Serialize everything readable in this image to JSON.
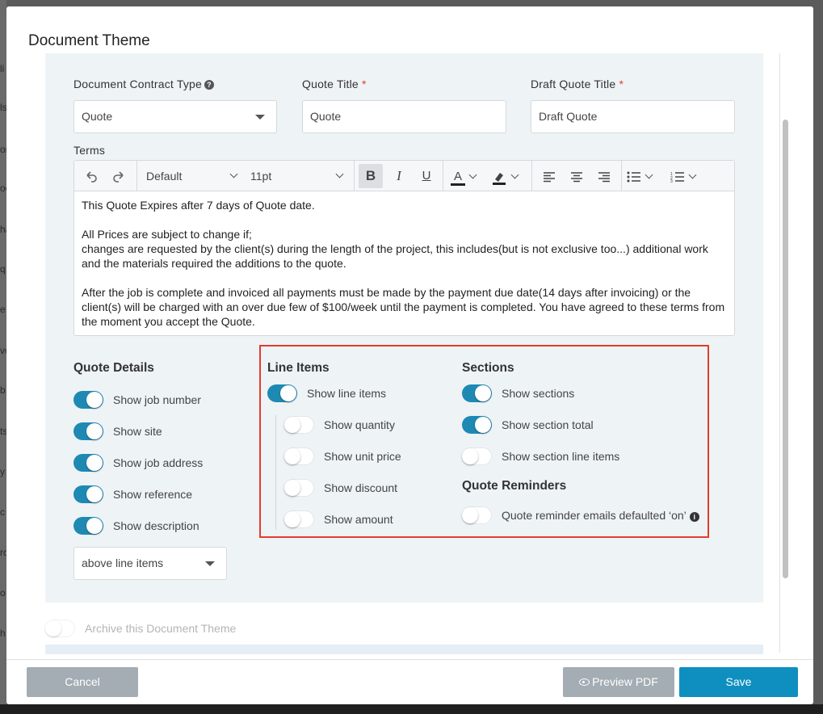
{
  "background_fragments": [
    "li",
    "ls",
    "on",
    "oc",
    "ha",
    "q",
    "e",
    "vo",
    "b",
    "ts",
    "y",
    "c",
    "rc",
    "o",
    "h"
  ],
  "modal": {
    "title": "Document Theme"
  },
  "fields": {
    "contract_type": {
      "label": "Document Contract Type",
      "value": "Quote"
    },
    "quote_title": {
      "label": "Quote Title",
      "required_mark": "*",
      "value": "Quote"
    },
    "draft_title": {
      "label": "Draft Quote Title",
      "required_mark": "*",
      "value": "Draft Quote"
    }
  },
  "terms": {
    "label": "Terms",
    "toolbar": {
      "font_family": "Default",
      "font_size": "11pt"
    },
    "lines": [
      "This Quote Expires after 7 days of Quote date.",
      "All Prices are subject to change if;",
      "changes are requested by the client(s) during the length of the project, this includes(but is not exclusive too...) additional work and the materials required the additions to the quote.",
      "After the job is complete and invoiced all payments must be made by the payment due date(14 days after invoicing) or the client(s) will be charged with an over due few of $100/week until the payment is completed. You have agreed to these terms from the moment you accept the Quote."
    ]
  },
  "quote_details": {
    "title": "Quote Details",
    "toggles": [
      {
        "label": "Show job number",
        "on": true
      },
      {
        "label": "Show site",
        "on": true
      },
      {
        "label": "Show job address",
        "on": true
      },
      {
        "label": "Show reference",
        "on": true
      },
      {
        "label": "Show description",
        "on": true
      }
    ],
    "position_select": "above line items"
  },
  "line_items": {
    "title": "Line Items",
    "main_toggle": {
      "label": "Show line items",
      "on": true
    },
    "sub_toggles": [
      {
        "label": "Show quantity",
        "on": false
      },
      {
        "label": "Show unit price",
        "on": false
      },
      {
        "label": "Show discount",
        "on": false
      },
      {
        "label": "Show amount",
        "on": false
      }
    ]
  },
  "sections": {
    "title": "Sections",
    "toggles": [
      {
        "label": "Show sections",
        "on": true
      },
      {
        "label": "Show section total",
        "on": true
      },
      {
        "label": "Show section line items",
        "on": false
      }
    ]
  },
  "quote_reminders": {
    "title": "Quote Reminders",
    "toggle": {
      "label": "Quote reminder emails defaulted ‘on’",
      "on": false
    }
  },
  "archive": {
    "label": "Archive this Document Theme",
    "on": false
  },
  "footer": {
    "cancel": "Cancel",
    "preview": "Preview PDF",
    "save": "Save"
  },
  "colors": {
    "accent": "#1e8ab3",
    "save_button": "#0f8fbf",
    "highlight": "#e43b2c",
    "panel": "#eef3f6"
  }
}
